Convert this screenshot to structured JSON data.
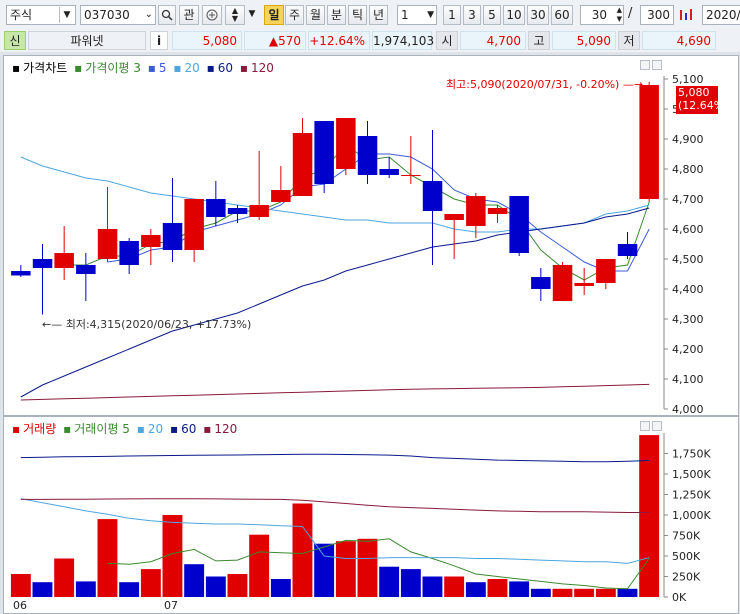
{
  "toolbar": {
    "market_type": "주식",
    "stock_code": "037030",
    "search_icon": "search-icon",
    "watch_label": "관",
    "periods": [
      "일",
      "주",
      "월",
      "분",
      "틱",
      "년"
    ],
    "active_period": "일",
    "unit_value": "1",
    "quick_units": [
      "1",
      "3",
      "5",
      "10",
      "30",
      "60"
    ],
    "count_value": "30",
    "total_value": "300",
    "settings_icon": "chart-settings-icon",
    "date_value": "2020/0"
  },
  "quote": {
    "badge": "신",
    "name": "파워넷",
    "info_label": "i",
    "price": "5,080",
    "change": "▲570",
    "change_pct": "+12.64%",
    "volume": "1,974,103",
    "open_label": "시",
    "open": "4,700",
    "high_label": "고",
    "high": "5,090",
    "low_label": "저",
    "low": "4,690",
    "up_color": "#e00000",
    "down_color": "#0000cc"
  },
  "price_panel": {
    "legend": [
      {
        "text": "가격차트",
        "color": "#000000"
      },
      {
        "text": "가격이평 3",
        "color": "#3a8a2e"
      },
      {
        "text": "5",
        "color": "#3b5bd9"
      },
      {
        "text": "20",
        "color": "#4da6e0"
      },
      {
        "text": "60",
        "color": "#0a1a8a"
      },
      {
        "text": "120",
        "color": "#8a1a3a"
      }
    ],
    "high_note": "최고:5,090(2020/07/31, -0.20%)",
    "low_note": "최저:4,315(2020/06/23, +17.73%)",
    "current_price_box": "5,080",
    "current_pct_box": "(12.64%)"
  },
  "volume_panel": {
    "legend": [
      {
        "text": "거래량",
        "color": "#e00000"
      },
      {
        "text": "거래이평 5",
        "color": "#3a8a2e"
      },
      {
        "text": "20",
        "color": "#4da6e0"
      },
      {
        "text": "60",
        "color": "#0a1a8a"
      },
      {
        "text": "120",
        "color": "#8a1a3a"
      }
    ],
    "x_labels": [
      "06",
      "07"
    ]
  },
  "chart_data": [
    {
      "type": "candlestick",
      "title": "가격차트",
      "ylim": [
        4000,
        5110
      ],
      "yticks": [
        "4,000",
        "4,100",
        "4,200",
        "4,300",
        "4,400",
        "4,500",
        "4,600",
        "4,700",
        "4,800",
        "4,900",
        "5,000",
        "5,100"
      ],
      "candles": [
        {
          "o": 4460,
          "c": 4445,
          "h": 4480,
          "l": 4440
        },
        {
          "o": 4500,
          "c": 4470,
          "h": 4550,
          "l": 4315
        },
        {
          "o": 4470,
          "c": 4520,
          "h": 4610,
          "l": 4430
        },
        {
          "o": 4480,
          "c": 4450,
          "h": 4520,
          "l": 4360
        },
        {
          "o": 4500,
          "c": 4600,
          "h": 4740,
          "l": 4490
        },
        {
          "o": 4560,
          "c": 4480,
          "h": 4570,
          "l": 4450
        },
        {
          "o": 4540,
          "c": 4580,
          "h": 4600,
          "l": 4480
        },
        {
          "o": 4620,
          "c": 4530,
          "h": 4770,
          "l": 4490
        },
        {
          "o": 4530,
          "c": 4700,
          "h": 4700,
          "l": 4490
        },
        {
          "o": 4700,
          "c": 4640,
          "h": 4760,
          "l": 4610
        },
        {
          "o": 4670,
          "c": 4650,
          "h": 4680,
          "l": 4620
        },
        {
          "o": 4640,
          "c": 4680,
          "h": 4860,
          "l": 4630
        },
        {
          "o": 4690,
          "c": 4730,
          "h": 4810,
          "l": 4690
        },
        {
          "o": 4710,
          "c": 4920,
          "h": 4970,
          "l": 4710
        },
        {
          "o": 4960,
          "c": 4750,
          "h": 4960,
          "l": 4720
        },
        {
          "o": 4800,
          "c": 4970,
          "h": 4970,
          "l": 4780
        },
        {
          "o": 4910,
          "c": 4780,
          "h": 4960,
          "l": 4750
        },
        {
          "o": 4800,
          "c": 4780,
          "h": 4840,
          "l": 4770
        },
        {
          "o": 4780,
          "c": 4780,
          "h": 4910,
          "l": 4750
        },
        {
          "o": 4760,
          "c": 4660,
          "h": 4930,
          "l": 4480
        },
        {
          "o": 4630,
          "c": 4650,
          "h": 4640,
          "l": 4500
        },
        {
          "o": 4610,
          "c": 4710,
          "h": 4720,
          "l": 4570
        },
        {
          "o": 4650,
          "c": 4670,
          "h": 4680,
          "l": 4620
        },
        {
          "o": 4710,
          "c": 4520,
          "h": 4710,
          "l": 4510
        },
        {
          "o": 4440,
          "c": 4400,
          "h": 4470,
          "l": 4360
        },
        {
          "o": 4360,
          "c": 4480,
          "h": 4490,
          "l": 4360
        },
        {
          "o": 4410,
          "c": 4420,
          "h": 4470,
          "l": 4380
        },
        {
          "o": 4420,
          "c": 4500,
          "h": 4500,
          "l": 4400
        },
        {
          "o": 4550,
          "c": 4510,
          "h": 4590,
          "l": 4500
        },
        {
          "o": 4700,
          "c": 5080,
          "h": 5090,
          "l": 4690
        }
      ],
      "ma": [
        {
          "name": "3",
          "values": [
            null,
            null,
            4480,
            4480,
            4510,
            4510,
            4550,
            4560,
            4600,
            4620,
            4660,
            4660,
            4690,
            4770,
            4800,
            4880,
            4830,
            4840,
            4780,
            4740,
            4700,
            4680,
            4680,
            4630,
            4530,
            4470,
            4430,
            4470,
            4480,
            4690
          ]
        },
        {
          "name": "5",
          "values": [
            null,
            null,
            null,
            null,
            4490,
            4500,
            4530,
            4540,
            4590,
            4610,
            4630,
            4650,
            4680,
            4740,
            4750,
            4800,
            4850,
            4850,
            4840,
            4800,
            4730,
            4700,
            4690,
            4650,
            4590,
            4540,
            4490,
            4460,
            4460,
            4600
          ]
        },
        {
          "name": "20",
          "values": [
            4840,
            4810,
            4790,
            4770,
            4760,
            4740,
            4720,
            4710,
            4700,
            4690,
            4680,
            4670,
            4660,
            4650,
            4640,
            4630,
            4630,
            4620,
            4620,
            4620,
            4600,
            4590,
            4590,
            4600,
            4600,
            4610,
            4620,
            4650,
            4660,
            4680
          ]
        },
        {
          "name": "60",
          "values": [
            4040,
            4080,
            4110,
            4140,
            4170,
            4200,
            4230,
            4260,
            4280,
            4300,
            4320,
            4350,
            4380,
            4410,
            4430,
            4460,
            4480,
            4500,
            4520,
            4540,
            4550,
            4560,
            4580,
            4590,
            4600,
            4610,
            4620,
            4640,
            4650,
            4670
          ]
        },
        {
          "name": "120",
          "values": [
            4030,
            4032,
            4034,
            4036,
            4038,
            4040,
            4042,
            4044,
            4046,
            4048,
            4050,
            4052,
            4054,
            4056,
            4058,
            4060,
            4062,
            4064,
            4066,
            4067,
            4068,
            4069,
            4070,
            4071,
            4072,
            4074,
            4076,
            4078,
            4080,
            4082
          ]
        }
      ]
    },
    {
      "type": "bar",
      "title": "거래량",
      "ylim": [
        0,
        2000000
      ],
      "yticks": [
        "0K",
        "250K",
        "500K",
        "750K",
        "1,000K",
        "1,250K",
        "1,500K",
        "1,750K"
      ],
      "values": [
        280000,
        180000,
        470000,
        190000,
        950000,
        180000,
        340000,
        1000000,
        400000,
        250000,
        280000,
        760000,
        220000,
        1140000,
        650000,
        680000,
        710000,
        370000,
        340000,
        250000,
        250000,
        180000,
        220000,
        190000,
        100000,
        100000,
        100000,
        100000,
        100000,
        1974103
      ],
      "up": [
        true,
        false,
        true,
        false,
        true,
        false,
        true,
        true,
        false,
        false,
        true,
        true,
        false,
        true,
        false,
        true,
        true,
        false,
        false,
        false,
        true,
        false,
        true,
        false,
        false,
        true,
        true,
        true,
        false,
        true
      ],
      "ma": [
        {
          "name": "5",
          "values": [
            null,
            null,
            null,
            null,
            410000,
            400000,
            430000,
            530000,
            580000,
            440000,
            450000,
            550000,
            540000,
            530000,
            610000,
            690000,
            680000,
            710000,
            550000,
            470000,
            380000,
            280000,
            250000,
            220000,
            190000,
            160000,
            140000,
            110000,
            100000,
            470000
          ]
        },
        {
          "name": "20",
          "values": [
            1200000,
            1150000,
            1100000,
            1050000,
            1010000,
            960000,
            930000,
            910000,
            900000,
            890000,
            890000,
            880000,
            870000,
            860000,
            500000,
            470000,
            470000,
            480000,
            480000,
            480000,
            480000,
            470000,
            470000,
            460000,
            450000,
            440000,
            430000,
            430000,
            410000,
            480000
          ]
        },
        {
          "name": "60",
          "values": [
            1700000,
            1705000,
            1710000,
            1712000,
            1715000,
            1720000,
            1722000,
            1725000,
            1728000,
            1730000,
            1732000,
            1735000,
            1738000,
            1740000,
            1740000,
            1738000,
            1735000,
            1730000,
            1720000,
            1700000,
            1690000,
            1680000,
            1670000,
            1665000,
            1660000,
            1655000,
            1650000,
            1650000,
            1655000,
            1665000
          ]
        },
        {
          "name": "120",
          "values": [
            1190000,
            1190000,
            1192000,
            1193000,
            1195000,
            1196000,
            1197000,
            1198000,
            1198000,
            1196000,
            1194000,
            1192000,
            1190000,
            1180000,
            1160000,
            1140000,
            1120000,
            1100000,
            1090000,
            1080000,
            1070000,
            1060000,
            1050000,
            1045000,
            1040000,
            1040000,
            1040000,
            1035000,
            1030000,
            1030000
          ]
        }
      ]
    }
  ]
}
